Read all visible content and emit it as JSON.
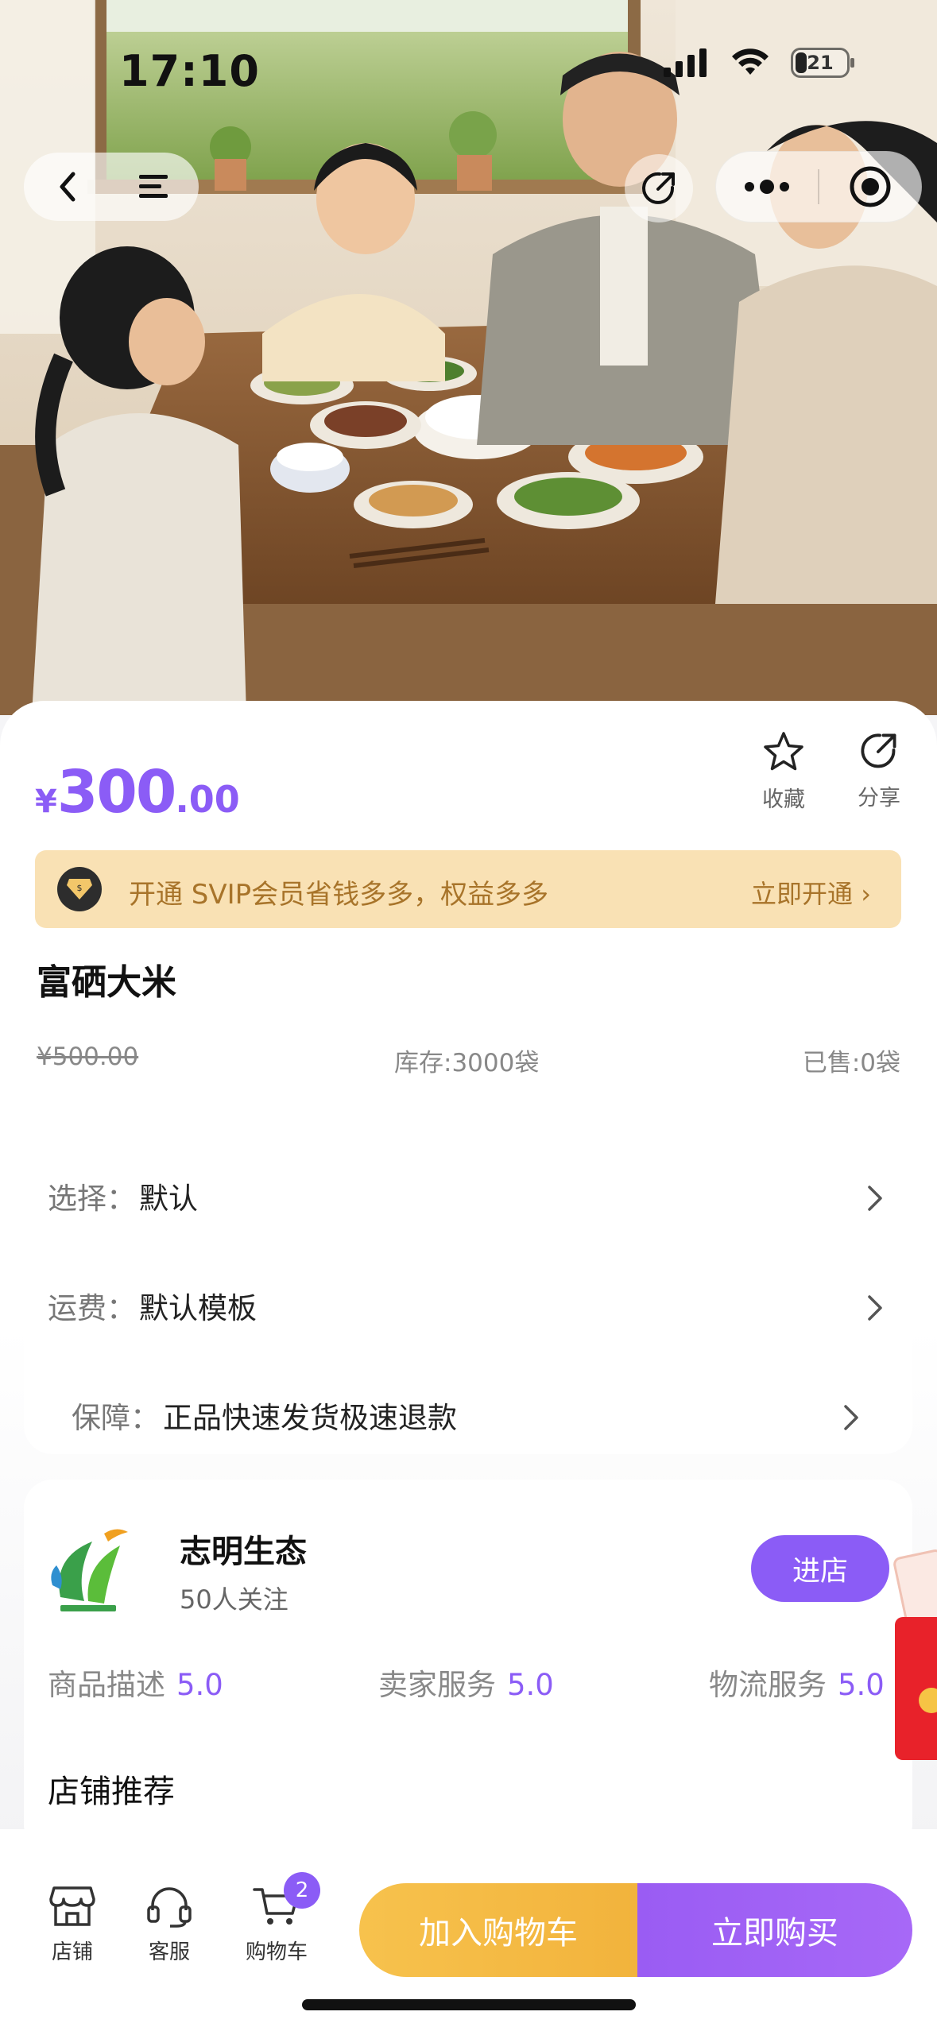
{
  "status": {
    "time": "17:10",
    "battery": "21"
  },
  "product": {
    "price_symbol": "¥",
    "price_integer": "300",
    "price_decimal": ".00",
    "title": "富硒大米",
    "original_price": "¥500.00",
    "stock": "库存:3000袋",
    "sold": "已售:0袋"
  },
  "actions": {
    "favorite_label": "收藏",
    "share_label": "分享"
  },
  "svip": {
    "text": "开通 SVIP会员省钱多多，权益多多",
    "cta": "立即开通 ›"
  },
  "options": [
    {
      "key": "选择：",
      "value": "默认"
    },
    {
      "key": "运费：",
      "value": "默认模板"
    },
    {
      "key": "保障：",
      "value": "正品快速发货极速退款"
    }
  ],
  "store": {
    "name": "志明生态",
    "followers": "50人关注",
    "enter_label": "进店",
    "ratings": [
      {
        "label": "商品描述",
        "score": "5.0"
      },
      {
        "label": "卖家服务",
        "score": "5.0"
      },
      {
        "label": "物流服务",
        "score": "5.0"
      }
    ],
    "recommend_title": "店铺推荐"
  },
  "bottom_bar": {
    "tabs": [
      {
        "label": "店铺"
      },
      {
        "label": "客服"
      },
      {
        "label": "购物车"
      }
    ],
    "cart_count": "2",
    "add_to_cart": "加入购物车",
    "buy_now": "立即购买"
  },
  "colors": {
    "accent": "#8b5cf6",
    "svip_bg": "#f9e1b4",
    "svip_text": "#a8742a",
    "add_cart": "#f2b33c"
  }
}
